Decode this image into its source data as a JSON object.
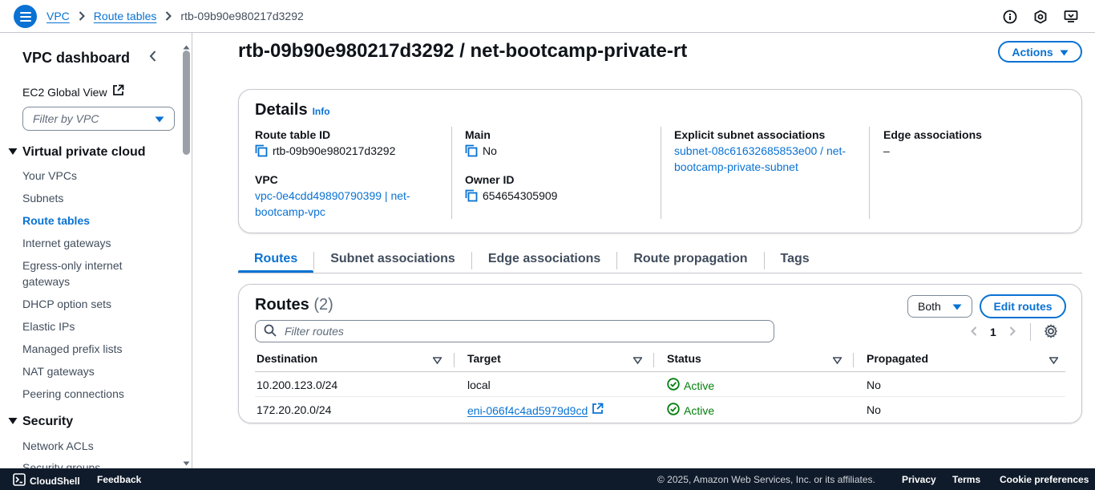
{
  "breadcrumb": {
    "root": "VPC",
    "section": "Route tables",
    "current": "rtb-09b90e980217d3292"
  },
  "sidebar": {
    "title": "VPC dashboard",
    "ec2_global_view": "EC2 Global View",
    "filter_placeholder": "Filter by VPC",
    "section_vpc": "Virtual private cloud",
    "items": [
      {
        "label": "Your VPCs"
      },
      {
        "label": "Subnets"
      },
      {
        "label": "Route tables",
        "active": true
      },
      {
        "label": "Internet gateways"
      },
      {
        "label": "Egress-only internet gateways"
      },
      {
        "label": "DHCP option sets"
      },
      {
        "label": "Elastic IPs"
      },
      {
        "label": "Managed prefix lists"
      },
      {
        "label": "NAT gateways"
      },
      {
        "label": "Peering connections"
      }
    ],
    "section_security": "Security",
    "security_items": [
      {
        "label": "Network ACLs"
      },
      {
        "label": "Security groups"
      }
    ]
  },
  "page": {
    "title": "rtb-09b90e980217d3292 / net-bootcamp-private-rt",
    "actions_label": "Actions"
  },
  "details": {
    "heading": "Details",
    "info": "Info",
    "route_table_id_label": "Route table ID",
    "route_table_id": "rtb-09b90e980217d3292",
    "vpc_label": "VPC",
    "vpc_value_line1": "vpc-0e4cdd49890790399 | net-",
    "vpc_value_line2": "bootcamp-vpc",
    "main_label": "Main",
    "main_value": "No",
    "owner_label": "Owner ID",
    "owner_value": "654654305909",
    "explicit_label": "Explicit subnet associations",
    "explicit_line1": "subnet-08c61632685853e00 / net-",
    "explicit_line2": "bootcamp-private-subnet",
    "edge_label": "Edge associations",
    "edge_value": "–"
  },
  "tabs": [
    {
      "label": "Routes",
      "active": true
    },
    {
      "label": "Subnet associations"
    },
    {
      "label": "Edge associations"
    },
    {
      "label": "Route propagation"
    },
    {
      "label": "Tags"
    }
  ],
  "routes": {
    "heading": "Routes",
    "count": "(2)",
    "filter_select": "Both",
    "edit_label": "Edit routes",
    "filter_placeholder": "Filter routes",
    "page_number": "1",
    "columns": [
      "Destination",
      "Target",
      "Status",
      "Propagated"
    ],
    "rows": [
      {
        "destination": "10.200.123.0/24",
        "target": "local",
        "target_link": false,
        "status": "Active",
        "propagated": "No"
      },
      {
        "destination": "172.20.20.0/24",
        "target": "eni-066f4c4ad5979d9cd",
        "target_link": true,
        "status": "Active",
        "propagated": "No"
      }
    ]
  },
  "footer": {
    "cloudshell": "CloudShell",
    "feedback": "Feedback",
    "copyright": "© 2025, Amazon Web Services, Inc. or its affiliates.",
    "privacy": "Privacy",
    "terms": "Terms",
    "cookies": "Cookie preferences"
  },
  "colors": {
    "accent": "#0972d3",
    "success": "#037f0c",
    "footer_bg": "#0f1b2a"
  }
}
